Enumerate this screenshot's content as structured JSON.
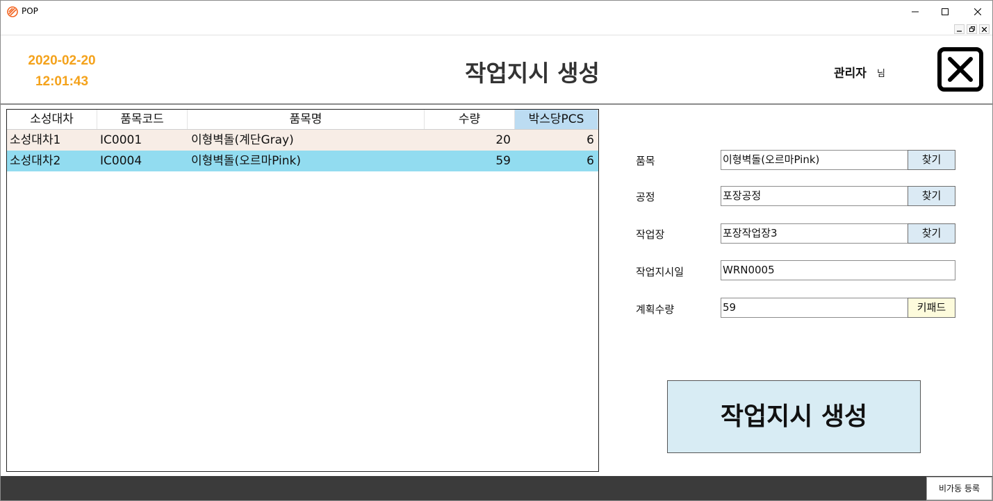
{
  "window": {
    "title": "POP",
    "accent": "#f26522"
  },
  "header": {
    "date": "2020-02-20",
    "time": "12:01:43",
    "title": "작업지시 생성",
    "user_name": "관리자",
    "user_suffix": "님",
    "datetime_color": "#f4a21b"
  },
  "table": {
    "columns": [
      "소성대차",
      "품목코드",
      "품목명",
      "수량",
      "박스당PCS"
    ],
    "selected_column": 4,
    "rows": [
      {
        "cart": "소성대차1",
        "code": "IC0001",
        "name": "이형벽돌(계단Gray)",
        "qty": "20",
        "pcs": "6",
        "bg": "#f7ede6"
      },
      {
        "cart": "소성대차2",
        "code": "IC0004",
        "name": "이형벽돌(오르마Pink)",
        "qty": "59",
        "pcs": "6",
        "bg": "#92dcf0"
      }
    ]
  },
  "form": {
    "item": {
      "label": "품목",
      "value": "이형벽돌(오르마Pink)",
      "button": "찾기"
    },
    "process": {
      "label": "공정",
      "value": "포장공정",
      "button": "찾기"
    },
    "workshop": {
      "label": "작업장",
      "value": "포장작업장3",
      "button": "찾기"
    },
    "order_no": {
      "label": "작업지시일",
      "value": "WRN0005"
    },
    "plan_qty": {
      "label": "계획수량",
      "value": "59",
      "button": "키패드"
    }
  },
  "actions": {
    "create": "작업지시 생성",
    "downtime": "비가동 등록"
  }
}
